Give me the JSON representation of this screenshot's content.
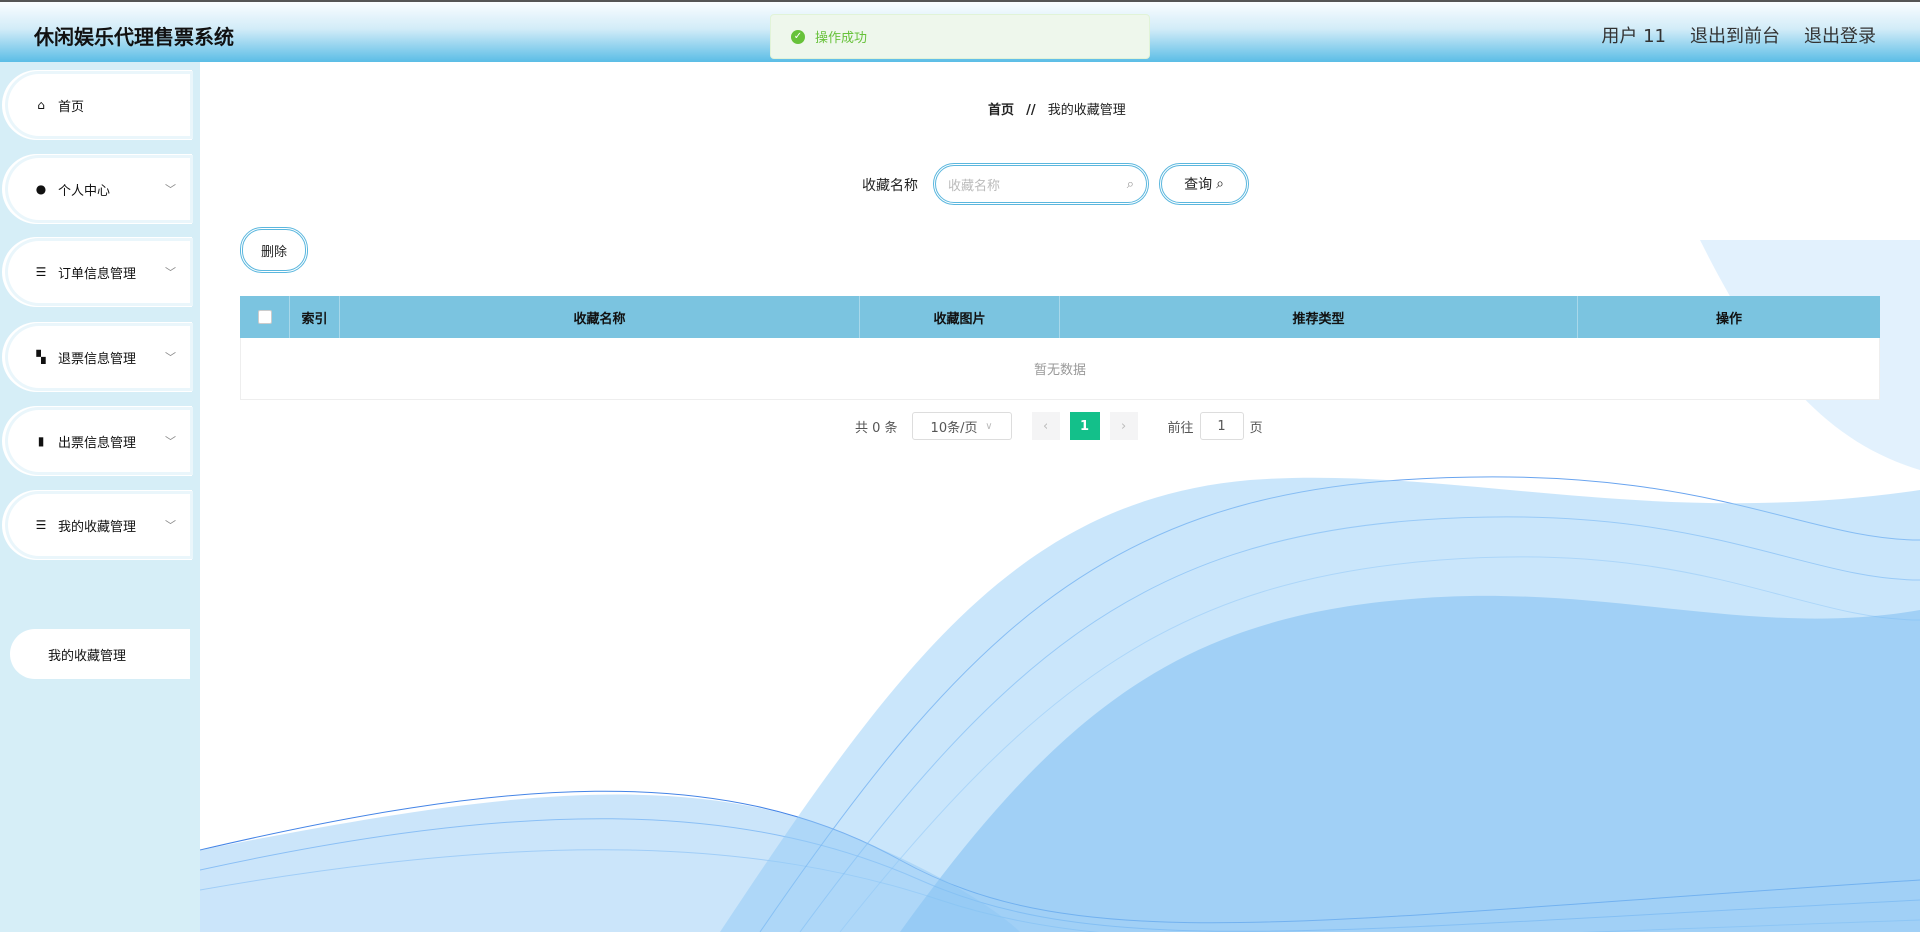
{
  "header": {
    "title": "休闲娱乐代理售票系统",
    "user": "用户 11",
    "to_front": "退出到前台",
    "logout": "退出登录"
  },
  "toast": {
    "message": "操作成功"
  },
  "sidebar": {
    "items": [
      {
        "label": "首页",
        "icon": "home-icon"
      },
      {
        "label": "个人中心",
        "icon": "user-icon"
      },
      {
        "label": "订单信息管理",
        "icon": "list-icon"
      },
      {
        "label": "退票信息管理",
        "icon": "ticket-icon"
      },
      {
        "label": "出票信息管理",
        "icon": "book-icon"
      },
      {
        "label": "我的收藏管理",
        "icon": "menu-icon"
      }
    ],
    "sub_item": "我的收藏管理"
  },
  "breadcrumb": {
    "home": "首页",
    "sep": "//",
    "current": "我的收藏管理"
  },
  "search": {
    "label": "收藏名称",
    "placeholder": "收藏名称",
    "button": "查询"
  },
  "actions": {
    "delete": "删除"
  },
  "table": {
    "columns": [
      "索引",
      "收藏名称",
      "收藏图片",
      "推荐类型",
      "操作"
    ],
    "empty": "暂无数据"
  },
  "pagination": {
    "total": "共 0 条",
    "page_size": "10条/页",
    "current": "1",
    "goto": "前往",
    "goto_value": "1",
    "page_unit": "页"
  },
  "colors": {
    "header": "#5bbde6",
    "sidebar": "#d6eef7",
    "table_header": "#7bc4e0",
    "active_page": "#13c08a"
  }
}
